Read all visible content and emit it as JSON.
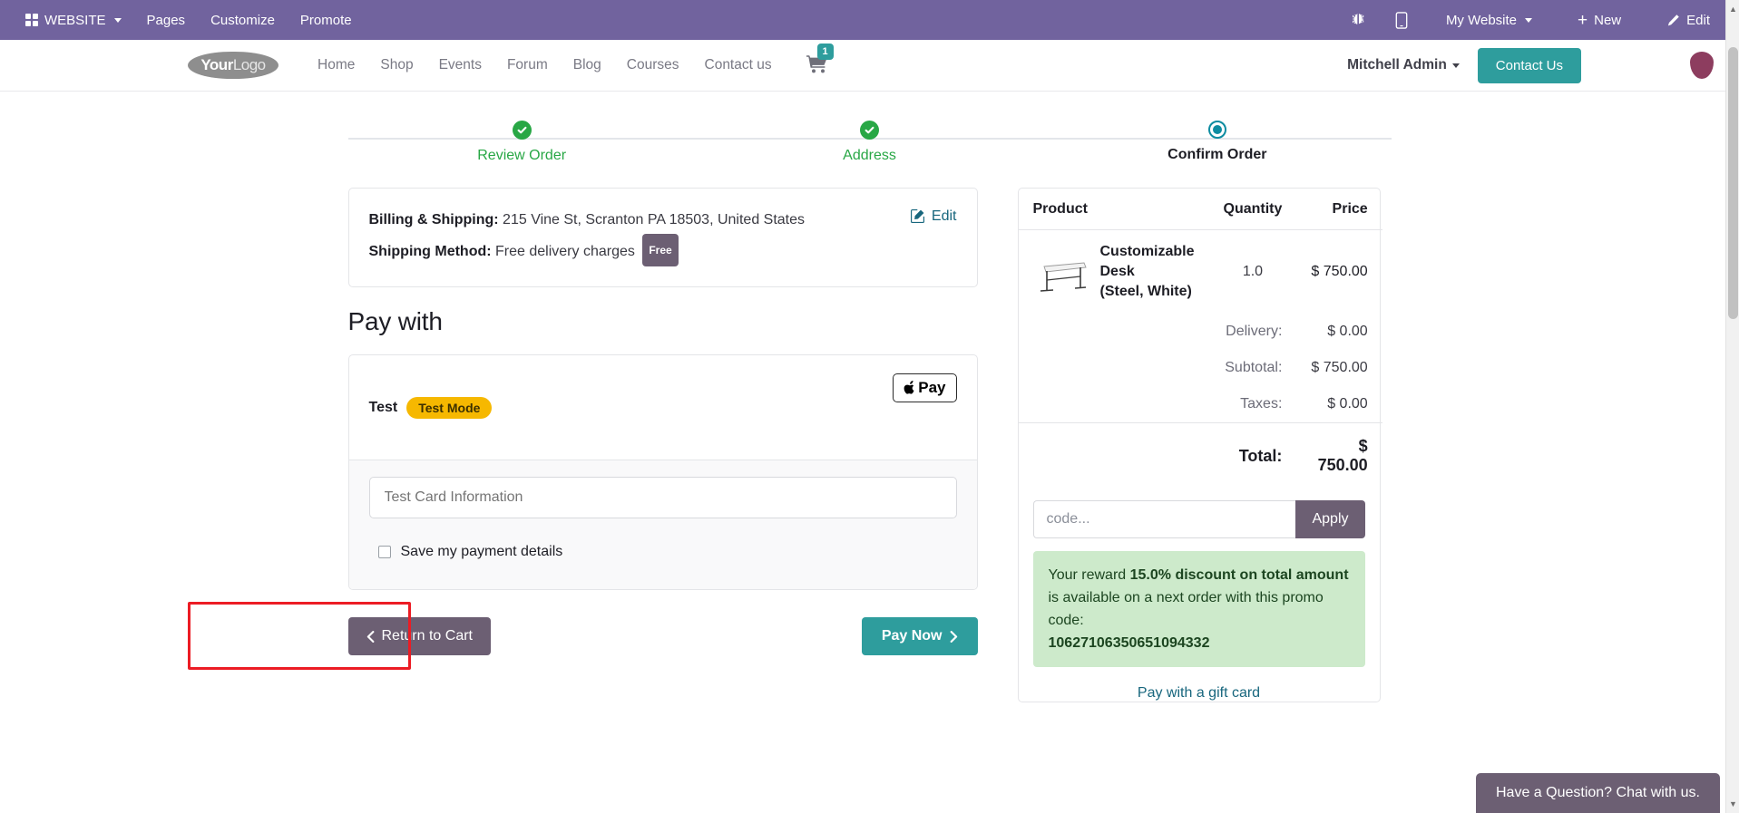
{
  "admin_bar": {
    "apps_label": "WEBSITE",
    "menus": [
      "Pages",
      "Customize",
      "Promote"
    ],
    "bug_icon": "bug-icon",
    "mobile_icon": "mobile-preview-icon",
    "website_selector": "My Website",
    "new_label": "New",
    "edit_label": "Edit"
  },
  "site_header": {
    "logo_part1": "Your",
    "logo_part2": "Logo",
    "nav": [
      "Home",
      "Shop",
      "Events",
      "Forum",
      "Blog",
      "Courses",
      "Contact us"
    ],
    "cart_count": "1",
    "user": "Mitchell Admin",
    "contact_button": "Contact Us"
  },
  "stepper": {
    "steps": [
      {
        "label": "Review Order",
        "state": "done"
      },
      {
        "label": "Address",
        "state": "done"
      },
      {
        "label": "Confirm Order",
        "state": "current"
      }
    ]
  },
  "address_card": {
    "billing_label": "Billing & Shipping:",
    "billing_value": "215 Vine St, Scranton PA 18503, United States",
    "shipping_label": "Shipping Method:",
    "shipping_value": "Free delivery charges",
    "shipping_badge": "Free",
    "edit_label": "Edit"
  },
  "payment": {
    "section_title": "Pay with",
    "method_name": "Test",
    "method_badge": "Test Mode",
    "apple_pay_label": "Pay",
    "card_input_placeholder": "Test Card Information",
    "card_input_value": "",
    "save_details_label": "Save my payment details",
    "save_details_checked": false,
    "return_to_cart": "Return to Cart",
    "pay_now": "Pay Now"
  },
  "summary": {
    "headers": {
      "product": "Product",
      "quantity": "Quantity",
      "price": "Price"
    },
    "line_item": {
      "name_line1": "Customizable Desk",
      "name_line2": "(Steel, White)",
      "quantity": "1.0",
      "price": "$ 750.00"
    },
    "amounts": [
      {
        "label": "Delivery:",
        "value": "$ 0.00"
      },
      {
        "label": "Subtotal:",
        "value": "$ 750.00"
      },
      {
        "label": "Taxes:",
        "value": "$ 0.00"
      }
    ],
    "total_label": "Total:",
    "total_value": "$ 750.00",
    "promo_placeholder": "code...",
    "promo_value": "",
    "apply_label": "Apply",
    "reward": {
      "prefix": "Your reward ",
      "highlight": "15.0% discount on total amount",
      "middle": " is available on a next order with this promo code:",
      "code": "10627106350651094332"
    },
    "giftcard_link": "Pay with a gift card"
  },
  "chat": {
    "label": "Have a Question? Chat with us."
  },
  "colors": {
    "admin_bar": "#71639e",
    "brand_teal": "#2e9d9d",
    "accent_purple": "#6c5f73",
    "success_green": "#28a745",
    "current_step": "#0d8ca1",
    "test_mode_yellow": "#f6b800",
    "reward_green_bg": "#cdeacb",
    "highlight_box": "#ec1c24"
  }
}
